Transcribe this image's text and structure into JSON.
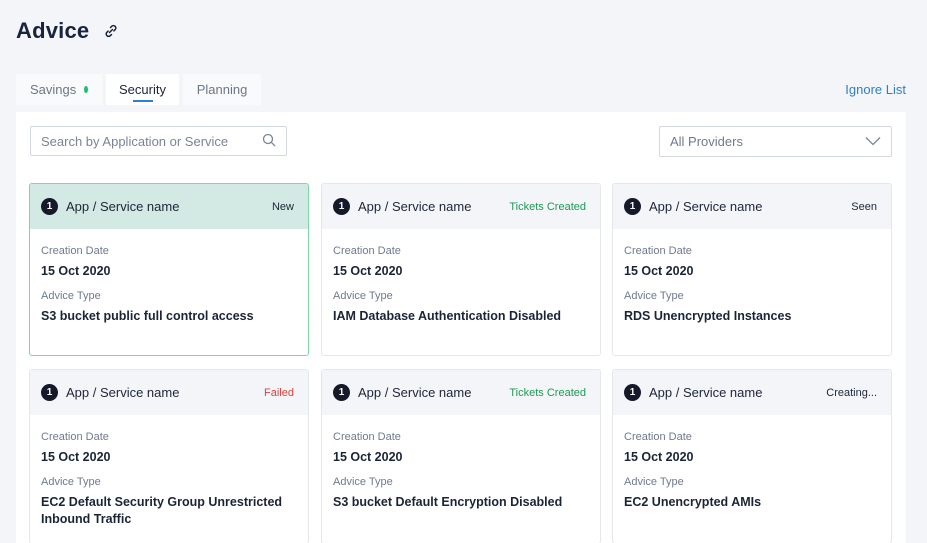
{
  "page": {
    "title": "Advice",
    "link_icon": "link-icon"
  },
  "tabs": [
    {
      "label": "Savings",
      "active": false,
      "has_indicator": true,
      "indicator_color": "#1fbf6d"
    },
    {
      "label": "Security",
      "active": true
    },
    {
      "label": "Planning",
      "active": false
    }
  ],
  "ignore_list_label": "Ignore List",
  "search": {
    "placeholder": "Search by Application or Service",
    "icon": "search-icon"
  },
  "provider_filter": {
    "selected": "All Providers",
    "icon": "chevron-down-icon"
  },
  "colors": {
    "accent": "#2f80d1",
    "success": "#1d9a52",
    "error": "#e0413d",
    "highlight_bg": "#d2eae3",
    "highlight_border": "#7ad8a6"
  },
  "cards": [
    {
      "number": "1",
      "name": "App / Service name",
      "status": "New",
      "status_tone": "default",
      "highlighted": true,
      "creation_label": "Creation Date",
      "creation_date": "15 Oct 2020",
      "type_label": "Advice Type",
      "advice_type": "S3 bucket public full control access"
    },
    {
      "number": "1",
      "name": "App / Service name",
      "status": "Tickets Created",
      "status_tone": "green",
      "highlighted": false,
      "creation_label": "Creation Date",
      "creation_date": "15 Oct 2020",
      "type_label": "Advice Type",
      "advice_type": "IAM Database Authentication Disabled"
    },
    {
      "number": "1",
      "name": "App / Service name",
      "status": "Seen",
      "status_tone": "default",
      "highlighted": false,
      "creation_label": "Creation Date",
      "creation_date": "15 Oct 2020",
      "type_label": "Advice Type",
      "advice_type": "RDS Unencrypted Instances"
    },
    {
      "number": "1",
      "name": "App / Service name",
      "status": "Failed",
      "status_tone": "red",
      "highlighted": false,
      "creation_label": "Creation Date",
      "creation_date": "15 Oct 2020",
      "type_label": "Advice Type",
      "advice_type": "EC2 Default Security Group Unrestricted Inbound Traffic"
    },
    {
      "number": "1",
      "name": "App / Service name",
      "status": "Tickets Created",
      "status_tone": "green",
      "highlighted": false,
      "creation_label": "Creation Date",
      "creation_date": "15 Oct 2020",
      "type_label": "Advice Type",
      "advice_type": "S3 bucket Default Encryption Disabled"
    },
    {
      "number": "1",
      "name": "App / Service name",
      "status": "Creating...",
      "status_tone": "default",
      "highlighted": false,
      "creation_label": "Creation Date",
      "creation_date": "15 Oct 2020",
      "type_label": "Advice Type",
      "advice_type": "EC2 Unencrypted AMIs"
    }
  ]
}
